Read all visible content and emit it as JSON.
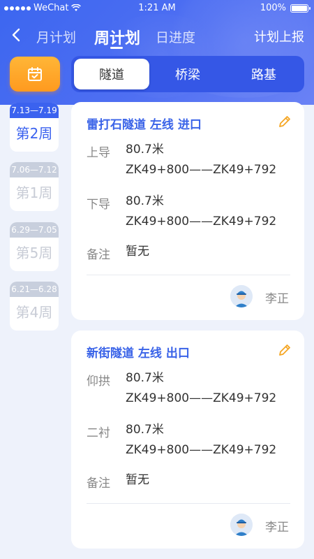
{
  "status_bar": {
    "carrier": "WeChat",
    "time": "1:21 AM",
    "battery": "100%"
  },
  "nav": {
    "tabs": [
      "月计划",
      "周计划",
      "日进度"
    ],
    "active_tab": "周计划",
    "report_label": "计划上报"
  },
  "segments": {
    "items": [
      "隧道",
      "桥梁",
      "路基"
    ],
    "active": "隧道"
  },
  "weeks": [
    {
      "range": "7.13—7.19",
      "label": "第2周",
      "active": true
    },
    {
      "range": "7.06—7.12",
      "label": "第1周",
      "active": false
    },
    {
      "range": "6.29—7.05",
      "label": "第5周",
      "active": false
    },
    {
      "range": "6.21—6.28",
      "label": "第4周",
      "active": false
    }
  ],
  "cards": [
    {
      "title": "雷打石隧道  左线  进口",
      "rows": [
        {
          "label": "上导",
          "length": "80.7米",
          "range": "ZK49+800——ZK49+792"
        },
        {
          "label": "下导",
          "length": "80.7米",
          "range": "ZK49+800——ZK49+792"
        }
      ],
      "note_label": "备注",
      "note_value": "暂无",
      "person": "李正"
    },
    {
      "title": "新街隧道  左线  出口",
      "rows": [
        {
          "label": "仰拱",
          "length": "80.7米",
          "range": "ZK49+800——ZK49+792"
        },
        {
          "label": "二衬",
          "length": "80.7米",
          "range": "ZK49+800——ZK49+792"
        }
      ],
      "note_label": "备注",
      "note_value": "暂无",
      "person": "李正"
    }
  ],
  "colors": {
    "primary": "#3b62ef",
    "accent_orange": "#ff9a1f",
    "inactive_week": "#c8cfdd"
  },
  "icons": {
    "back": "chevron-left-icon",
    "calendar": "calendar-check-icon",
    "edit": "pencil-icon",
    "avatar": "worker-avatar-icon"
  }
}
